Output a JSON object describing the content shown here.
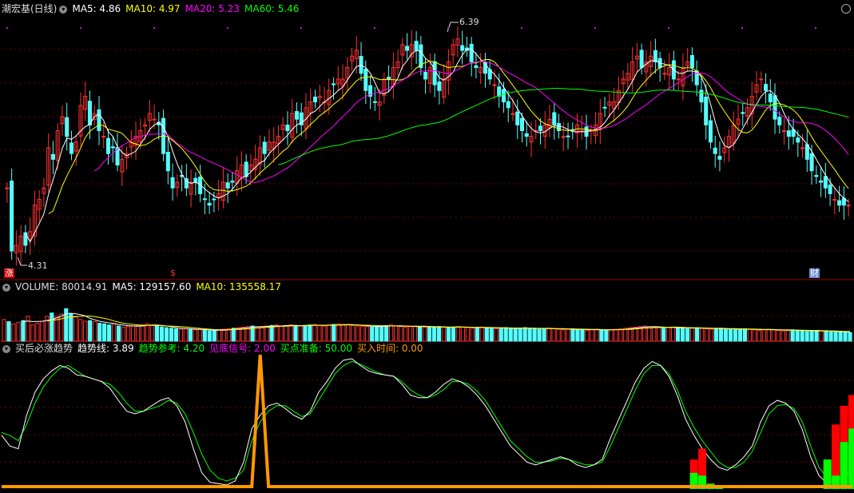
{
  "colors": {
    "up": "#ff3232",
    "down": "#54ffff",
    "ma5": "#ffffff",
    "ma10": "#ffff00",
    "ma20": "#ff00ff",
    "ma60": "#00ff00",
    "grid": "#7a0000",
    "sep": "#a00000",
    "orange": "#ff9900",
    "bar_red": "#ff0000",
    "bar_green": "#00ff00"
  },
  "header": {
    "title": "潮宏基(日线)",
    "ma5": "MA5: 4.86",
    "ma10": "MA10: 4.97",
    "ma20": "MA20: 5.23",
    "ma60": "MA60: 5.46"
  },
  "volume_header": {
    "label": "VOLUME: 80014.91",
    "ma5": "MA5: 129157.60",
    "ma10": "MA10: 135558.17"
  },
  "indicator_header": {
    "name": "买后必涨趋势",
    "trend": "趋势线: 3.89",
    "ref": "趋势参考: 4.20",
    "bottom": "见底信号: 2.00",
    "buyprep": "买点准备: 50.00",
    "buytime": "买入时间: 0.00"
  },
  "annotations": {
    "high": "6.39",
    "low": "4.31",
    "tag_zhang": "涨",
    "tag_s": "$",
    "tag_cai": "财"
  },
  "chart_data": [
    {
      "type": "candlestick",
      "title": "潮宏基(日线)",
      "ylim": [
        4.2,
        6.5
      ],
      "high_marker": 6.39,
      "low_marker": 4.31,
      "close": [
        5.0,
        4.45,
        4.5,
        4.58,
        4.5,
        4.62,
        4.85,
        4.9,
        5.0,
        5.35,
        5.25,
        5.5,
        5.62,
        5.45,
        5.3,
        5.4,
        5.72,
        5.8,
        5.55,
        5.65,
        5.5,
        5.45,
        5.3,
        5.35,
        5.2,
        5.25,
        5.3,
        5.4,
        5.45,
        5.5,
        5.55,
        5.65,
        5.6,
        5.55,
        5.3,
        5.15,
        5.0,
        5.05,
        5.1,
        5.0,
        5.05,
        5.05,
        4.95,
        4.9,
        4.85,
        4.9,
        4.95,
        5.05,
        5.0,
        5.05,
        5.15,
        5.2,
        5.1,
        5.2,
        5.25,
        5.35,
        5.3,
        5.4,
        5.4,
        5.45,
        5.55,
        5.5,
        5.65,
        5.6,
        5.55,
        5.7,
        5.75,
        5.75,
        5.8,
        5.75,
        5.85,
        5.9,
        5.95,
        5.95,
        6.05,
        6.15,
        6.2,
        6.0,
        5.85,
        5.8,
        5.75,
        5.75,
        5.95,
        5.95,
        6.05,
        6.1,
        6.25,
        6.2,
        6.25,
        6.2,
        6.05,
        5.95,
        6.05,
        5.9,
        5.85,
        5.95,
        6.1,
        6.25,
        6.3,
        6.2,
        6.2,
        6.1,
        6.05,
        6.05,
        6.0,
        5.95,
        5.9,
        5.8,
        5.75,
        5.7,
        5.65,
        5.55,
        5.5,
        5.45,
        5.45,
        5.5,
        5.5,
        5.55,
        5.6,
        5.55,
        5.5,
        5.45,
        5.45,
        5.5,
        5.55,
        5.5,
        5.45,
        5.5,
        5.55,
        5.65,
        5.7,
        5.75,
        5.75,
        5.85,
        5.95,
        6.0,
        6.1,
        6.15,
        6.05,
        6.1,
        6.15,
        6.1,
        6.05,
        6.0,
        6.05,
        5.95,
        5.95,
        6.05,
        6.1,
        6.05,
        5.9,
        5.75,
        5.55,
        5.4,
        5.3,
        5.25,
        5.35,
        5.45,
        5.55,
        5.6,
        5.65,
        5.7,
        5.8,
        5.9,
        5.95,
        5.85,
        5.75,
        5.6,
        5.55,
        5.5,
        5.45,
        5.45,
        5.4,
        5.35,
        5.25,
        5.15,
        5.1,
        5.05,
        5.0,
        4.95,
        4.9,
        4.85,
        4.85,
        4.85
      ]
    },
    {
      "type": "bar",
      "title": "VOLUME",
      "ylim": [
        0,
        450000
      ],
      "values": [
        200000,
        180000,
        160000,
        175000,
        190000,
        230000,
        150000,
        165000,
        185000,
        230000,
        260000,
        230000,
        250000,
        300000,
        250000,
        230000,
        200000,
        185000,
        190000,
        180000,
        165000,
        160000,
        150000,
        160000,
        140000,
        130000,
        135000,
        140000,
        145000,
        150000,
        160000,
        150000,
        140000,
        130000,
        125000,
        120000,
        115000,
        110000,
        115000,
        110000,
        105000,
        110000,
        100000,
        95000,
        100000,
        105000,
        110000,
        115000,
        120000,
        125000,
        130000,
        135000,
        140000,
        135000,
        130000,
        140000,
        145000,
        150000,
        140000,
        145000,
        150000,
        145000,
        140000,
        145000,
        150000,
        155000,
        145000,
        140000,
        150000,
        155000,
        160000,
        155000,
        150000,
        145000,
        140000,
        140000,
        135000,
        130000,
        135000,
        140000,
        145000,
        150000,
        140000,
        135000,
        130000,
        135000,
        140000,
        135000,
        130000,
        125000,
        130000,
        135000,
        130000,
        125000,
        130000,
        135000,
        130000,
        125000,
        120000,
        125000,
        130000,
        125000,
        120000,
        115000,
        120000,
        125000,
        120000,
        115000,
        120000,
        125000,
        120000,
        115000,
        110000,
        115000,
        120000,
        115000,
        110000,
        105000,
        110000,
        115000,
        110000,
        105000,
        100000,
        105000,
        110000,
        105000,
        100000,
        105000,
        110000,
        115000,
        120000,
        125000,
        130000,
        135000,
        140000,
        135000,
        130000,
        125000,
        120000,
        125000,
        130000,
        125000,
        120000,
        115000,
        120000,
        125000,
        120000,
        115000,
        110000,
        115000,
        120000,
        115000,
        110000,
        105000,
        110000,
        115000,
        110000,
        105000,
        100000,
        105000,
        110000,
        105000,
        100000,
        95000,
        100000,
        105000,
        100000,
        95000,
        90000,
        95000,
        100000,
        95000,
        90000,
        85000,
        90000,
        85000,
        80000,
        80014.91
      ]
    },
    {
      "type": "line",
      "title": "买后必涨趋势",
      "ylim": [
        0,
        100
      ],
      "series": [
        {
          "name": "趋势线",
          "values": [
            40,
            32,
            30,
            55,
            72,
            82,
            88,
            92,
            90,
            85,
            84,
            82,
            80,
            75,
            66,
            58,
            56,
            58,
            62,
            66,
            68,
            62,
            50,
            30,
            12,
            5,
            4,
            3,
            6,
            20,
            45,
            55,
            62,
            64,
            60,
            55,
            52,
            58,
            72,
            80,
            90,
            96,
            97,
            92,
            88,
            86,
            85,
            84,
            78,
            70,
            68,
            68,
            72,
            78,
            82,
            80,
            76,
            70,
            62,
            52,
            42,
            32,
            26,
            20,
            18,
            20,
            22,
            24,
            22,
            18,
            16,
            18,
            22,
            38,
            52,
            66,
            80,
            90,
            95,
            92,
            84,
            70,
            52,
            40,
            30,
            22,
            16,
            14,
            18,
            24,
            32,
            50,
            62,
            66,
            64,
            58,
            44,
            24,
            10,
            4,
            6,
            10,
            14
          ]
        },
        {
          "name": "趋势参考",
          "values": [
            42,
            40,
            36,
            48,
            64,
            76,
            84,
            90,
            92,
            88,
            84,
            82,
            80,
            78,
            72,
            64,
            58,
            58,
            60,
            62,
            66,
            64,
            56,
            42,
            26,
            14,
            8,
            6,
            8,
            14,
            36,
            50,
            58,
            62,
            62,
            58,
            54,
            56,
            66,
            76,
            86,
            92,
            95,
            93,
            90,
            87,
            85,
            84,
            80,
            74,
            70,
            68,
            70,
            74,
            80,
            80,
            78,
            73,
            66,
            56,
            46,
            36,
            30,
            24,
            20,
            20,
            21,
            23,
            22,
            20,
            18,
            18,
            20,
            32,
            46,
            60,
            74,
            86,
            92,
            92,
            86,
            74,
            58,
            46,
            36,
            28,
            20,
            16,
            16,
            20,
            28,
            42,
            56,
            62,
            63,
            60,
            50,
            32,
            16,
            8,
            6,
            8,
            12
          ]
        }
      ],
      "signals": {
        "见底信号": [
          0,
          0,
          0,
          0,
          0,
          0,
          0,
          0,
          0,
          0,
          0,
          0,
          0,
          0,
          0,
          0,
          0,
          0,
          0,
          0,
          0,
          0,
          0,
          0,
          0,
          0,
          0,
          0,
          0,
          0,
          0,
          0,
          0,
          0,
          0,
          0,
          0,
          0,
          0,
          0,
          0,
          0,
          0,
          0,
          0,
          0,
          0,
          0,
          0,
          0,
          0,
          0,
          0,
          0,
          0,
          0,
          0,
          0,
          0,
          0,
          0,
          0,
          0,
          0,
          0,
          0,
          0,
          0,
          0,
          0,
          0,
          0,
          0,
          0,
          0,
          0,
          0,
          0,
          0,
          0,
          0,
          0,
          0,
          12,
          10,
          4,
          2,
          0,
          0,
          0,
          0,
          0,
          0,
          0,
          0,
          0,
          0,
          0,
          0,
          22,
          10,
          35,
          45
        ],
        "买点准备": [
          0,
          0,
          0,
          0,
          0,
          0,
          0,
          0,
          0,
          0,
          0,
          0,
          0,
          0,
          0,
          0,
          0,
          0,
          0,
          0,
          0,
          0,
          0,
          0,
          0,
          0,
          0,
          0,
          0,
          0,
          0,
          0,
          0,
          0,
          0,
          0,
          0,
          0,
          0,
          0,
          0,
          0,
          0,
          0,
          0,
          0,
          0,
          0,
          0,
          0,
          0,
          0,
          0,
          0,
          0,
          0,
          0,
          0,
          0,
          0,
          0,
          0,
          0,
          0,
          0,
          0,
          0,
          0,
          0,
          0,
          0,
          0,
          0,
          0,
          0,
          0,
          0,
          0,
          0,
          0,
          0,
          0,
          0,
          22,
          30,
          4,
          0,
          0,
          0,
          0,
          0,
          0,
          0,
          0,
          0,
          0,
          0,
          0,
          0,
          20,
          48,
          62,
          70
        ],
        "买入时间": [
          0,
          0,
          0,
          0,
          0,
          0,
          0,
          0,
          0,
          0,
          0,
          0,
          0,
          0,
          0,
          0,
          0,
          0,
          0,
          0,
          0,
          0,
          0,
          0,
          0,
          0,
          0,
          0,
          0,
          0,
          0,
          100,
          0,
          0,
          0,
          0,
          0,
          0,
          0,
          0,
          0,
          0,
          0,
          0,
          0,
          0,
          0,
          0,
          0,
          0,
          0,
          0,
          0,
          0,
          0,
          0,
          0,
          0,
          0,
          0,
          0,
          0,
          0,
          0,
          0,
          0,
          0,
          0,
          0,
          0,
          0,
          0,
          0,
          0,
          0,
          0,
          0,
          0,
          0,
          0,
          0,
          0,
          0,
          0,
          0,
          0,
          0,
          0,
          0,
          0,
          0,
          0,
          0,
          0,
          0,
          0,
          0,
          0,
          0,
          0,
          0,
          0,
          0
        ]
      }
    }
  ]
}
